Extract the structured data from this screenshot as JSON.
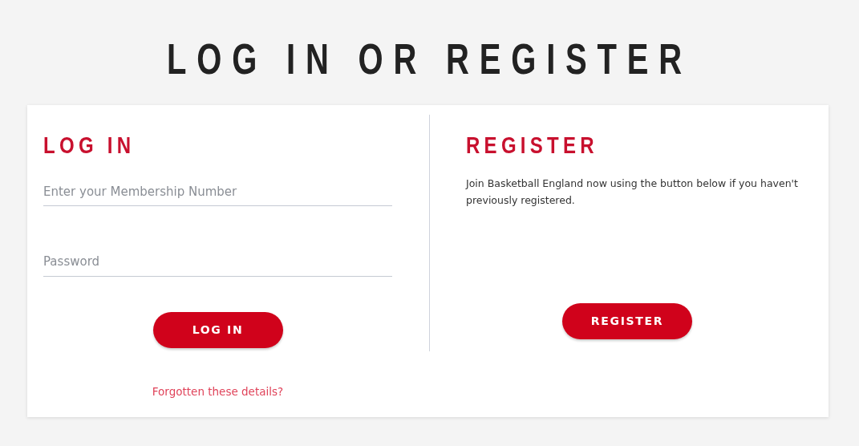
{
  "title": "LOG IN OR REGISTER",
  "login": {
    "heading": "LOG IN",
    "fields": [
      {
        "placeholder": "Enter your Membership Number"
      },
      {
        "placeholder": "Password"
      }
    ],
    "button": "LOG IN",
    "forgot_link": "Forgotten these details?"
  },
  "register": {
    "heading": "REGISTER",
    "text": "Join Basketball England now using the button below if you haven't previously registered.",
    "button": "REGISTER"
  }
}
